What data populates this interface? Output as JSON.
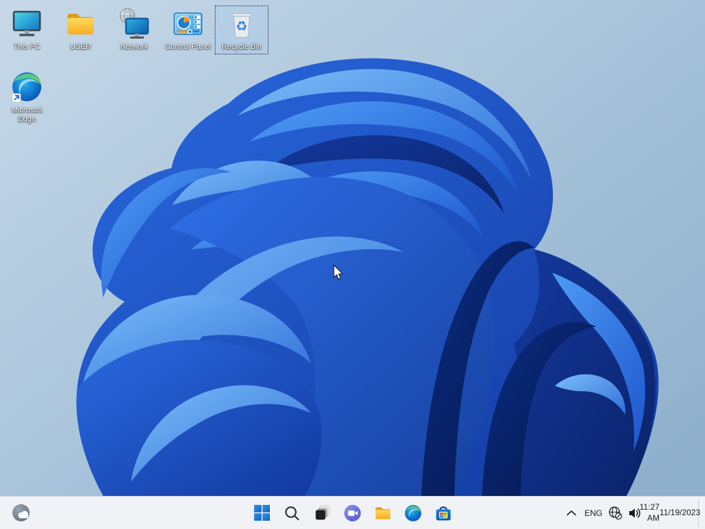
{
  "wallpaper": {
    "description": "Windows 11 blue bloom on light blue background",
    "bg_top": "#c7d9e8",
    "bg_bottom": "#8fb0cd",
    "bloom_bright": "#4e9cf5",
    "bloom_dark": "#0a2268"
  },
  "desktop": {
    "icons": [
      {
        "name": "this-pc",
        "label": "This PC",
        "selected": false
      },
      {
        "name": "user-folder",
        "label": "USER",
        "selected": false
      },
      {
        "name": "network",
        "label": "Network",
        "selected": false
      },
      {
        "name": "control-panel",
        "label": "Control Panel",
        "selected": false
      },
      {
        "name": "recycle-bin",
        "label": "Recycle Bin",
        "selected": true
      },
      {
        "name": "microsoft-edge",
        "label": "Microsoft Edge",
        "selected": false
      }
    ]
  },
  "taskbar": {
    "left_buttons": [
      "widgets-weather-icon"
    ],
    "center_buttons": [
      "start-icon",
      "search-icon",
      "task-view-icon",
      "chat-icon",
      "file-explorer-icon",
      "edge-icon",
      "store-icon"
    ],
    "tray": {
      "chevron": "chevron-up-icon",
      "language": "ENG",
      "status_icons": [
        "globe-no-internet-icon",
        "volume-icon"
      ],
      "time": "11:27 AM",
      "date": "11/19/2023"
    }
  }
}
